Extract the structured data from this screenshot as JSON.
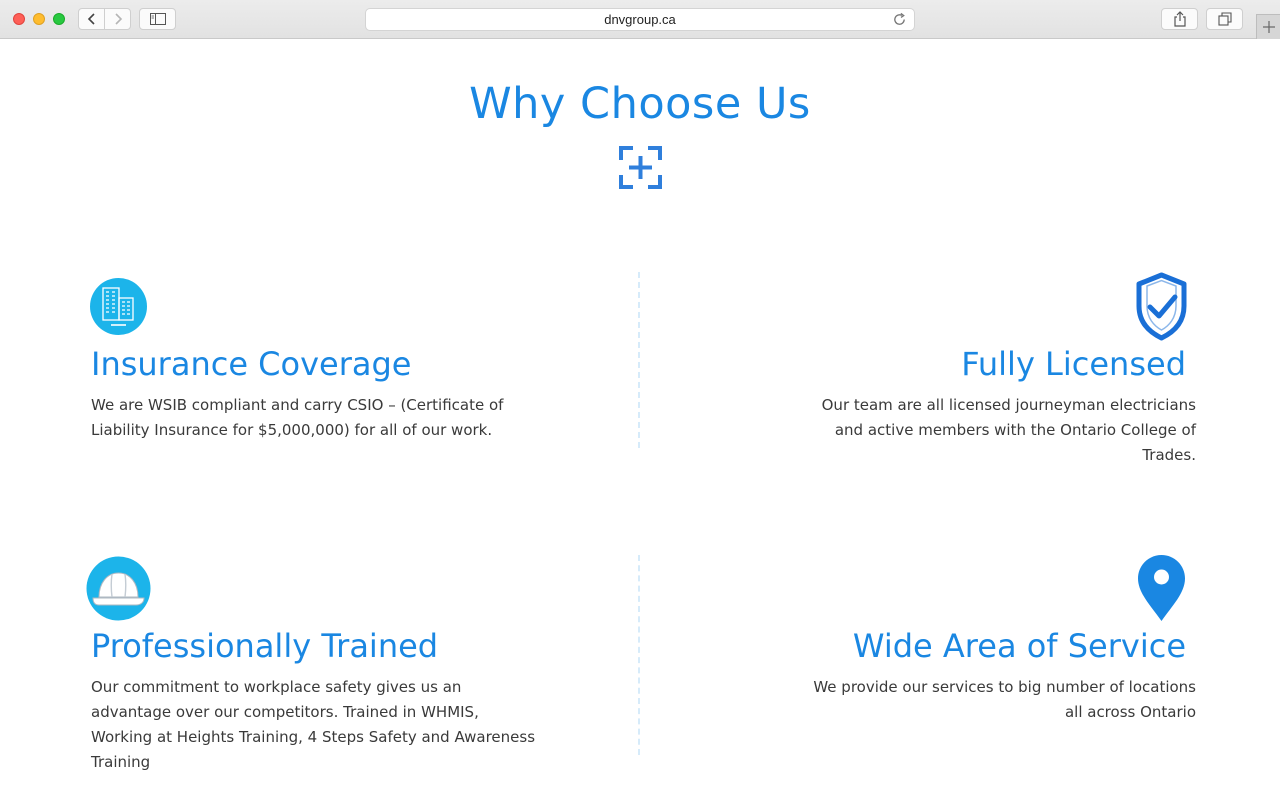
{
  "browser": {
    "url": "dnvgroup.ca"
  },
  "section": {
    "title": "Why Choose Us"
  },
  "features": [
    {
      "title": "Insurance Coverage",
      "text": "We are WSIB compliant and carry CSIO – (Certificate of Liability Insurance for $5,000,000) for all of our work.",
      "icon": "buildings-icon"
    },
    {
      "title": "Fully Licensed",
      "text": "Our team are all licensed journeyman electricians and active members with the Ontario College of Trades.",
      "icon": "shield-check-icon"
    },
    {
      "title": "Professionally Trained",
      "text": "Our commitment to workplace safety gives us an advantage over our competitors. Trained in WHMIS, Working at Heights Training, 4 Steps Safety and Awareness Training",
      "icon": "hard-hat-icon"
    },
    {
      "title": "Wide Area of Service",
      "text": "We provide our services to big number of locations all across Ontario",
      "icon": "map-pin-icon"
    }
  ],
  "colors": {
    "accent": "#1a87e2",
    "icon_circle": "#1cb4ea",
    "body_text": "#3a3a3a"
  }
}
